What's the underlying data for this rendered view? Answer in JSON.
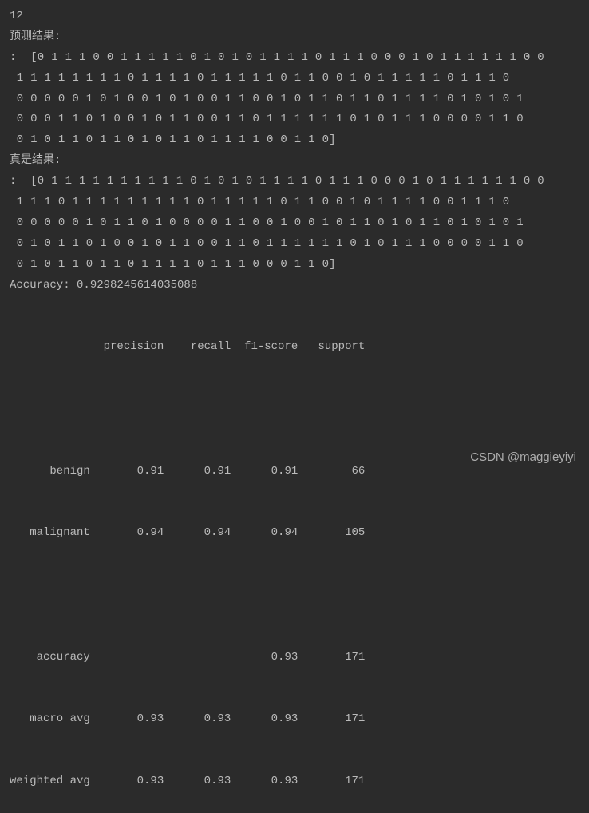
{
  "lines": {
    "num": "12",
    "pred_label": "预测结果:",
    "pred_array": ":  [0 1 1 1 0 0 1 1 1 1 1 0 1 0 1 0 1 1 1 1 0 1 1 1 0 0 0 1 0 1 1 1 1 1 1 0 0\n 1 1 1 1 1 1 1 1 0 1 1 1 1 0 1 1 1 1 1 0 1 1 0 0 1 0 1 1 1 1 1 0 1 1 1 0\n 0 0 0 0 0 1 0 1 0 0 1 0 1 0 0 1 1 0 0 1 0 1 1 0 1 1 0 1 1 1 1 0 1 0 1 0 1\n 0 0 0 1 1 0 1 0 0 1 0 1 1 0 0 1 1 0 1 1 1 1 1 1 0 1 0 1 1 1 0 0 0 0 1 1 0\n 0 1 0 1 1 0 1 1 0 1 0 1 1 0 1 1 1 1 0 0 1 1 0]",
    "true_label": "真是结果:",
    "true_array": ":  [0 1 1 1 1 1 1 1 1 1 1 0 1 0 1 0 1 1 1 1 0 1 1 1 0 0 0 1 0 1 1 1 1 1 1 0 0\n 1 1 1 0 1 1 1 1 1 1 1 1 1 0 1 1 1 1 1 0 1 1 0 0 1 0 1 1 1 1 0 0 1 1 1 0\n 0 0 0 0 0 1 0 1 1 0 1 0 0 0 0 1 1 0 0 1 0 0 1 0 1 1 0 1 0 1 1 0 1 0 1 0 1\n 0 1 0 1 1 0 1 0 0 1 0 1 1 0 0 1 1 0 1 1 1 1 1 1 0 1 0 1 1 1 0 0 0 0 1 1 0\n 0 1 0 1 1 0 1 1 0 1 1 1 1 0 1 1 1 0 0 0 1 1 0]",
    "accuracy": "Accuracy: 0.9298245614035088"
  },
  "report": {
    "header": "              precision    recall  f1-score   support",
    "benign": "      benign       0.91      0.91      0.91        66",
    "malignant": "   malignant       0.94      0.94      0.94       105",
    "accuracy_r": "    accuracy                           0.93       171",
    "macro": "   macro avg       0.93      0.93      0.93       171",
    "weighted": "weighted avg       0.93      0.93      0.93       171"
  },
  "chart_data": {
    "type": "table",
    "title": "Classification Report",
    "columns": [
      "",
      "precision",
      "recall",
      "f1-score",
      "support"
    ],
    "rows": [
      [
        "benign",
        0.91,
        0.91,
        0.91,
        66
      ],
      [
        "malignant",
        0.94,
        0.94,
        0.94,
        105
      ],
      [
        "accuracy",
        null,
        null,
        0.93,
        171
      ],
      [
        "macro avg",
        0.93,
        0.93,
        0.93,
        171
      ],
      [
        "weighted avg",
        0.93,
        0.93,
        0.93,
        171
      ]
    ],
    "overall_accuracy": 0.9298245614035088
  },
  "watermark": "CSDN @maggieyiyi"
}
